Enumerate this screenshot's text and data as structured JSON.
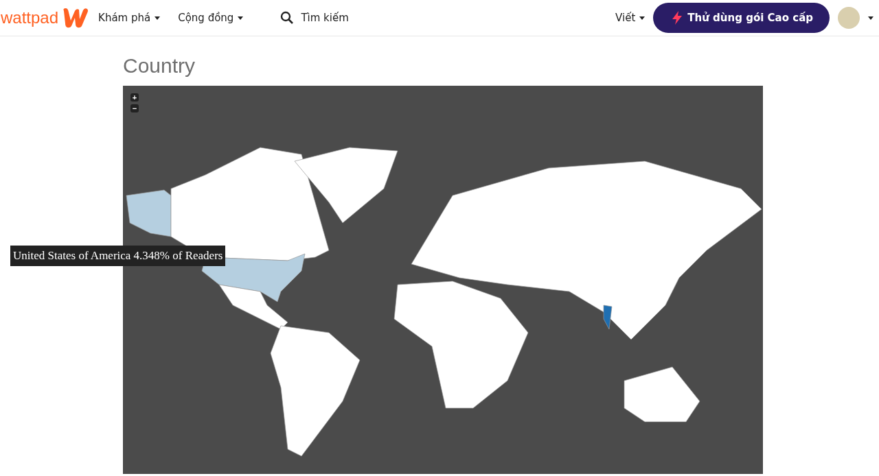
{
  "header": {
    "logo": "wattpad",
    "nav": [
      {
        "label": "Khám phá"
      },
      {
        "label": "Cộng đồng"
      }
    ],
    "search": {
      "placeholder": "Tìm kiếm"
    },
    "write": {
      "label": "Viết"
    },
    "premium_button": {
      "label": "Thử dùng gói Cao cấp"
    }
  },
  "section": {
    "title": "Country"
  },
  "map": {
    "zoom_controls": [
      "+",
      "−"
    ],
    "tooltip": "United States of America 4.348% of Readers"
  }
}
